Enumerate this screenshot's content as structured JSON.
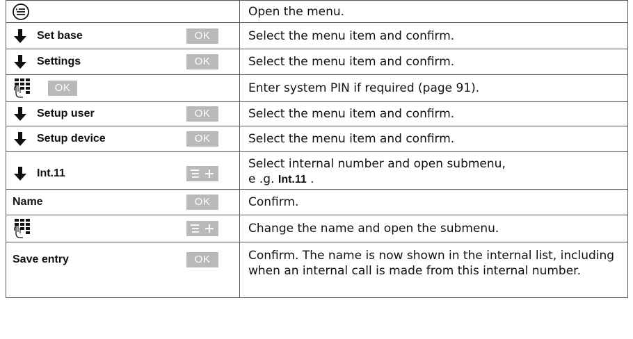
{
  "steps": [
    {
      "key": "menu-key-icon",
      "label": "",
      "button": "",
      "instruction": "Open the menu."
    },
    {
      "key": "arrow-down-icon",
      "label": "Set base",
      "button": "OK",
      "instruction": "Select the menu item and confirm."
    },
    {
      "key": "arrow-down-icon",
      "label": "Settings",
      "button": "OK",
      "instruction": "Select the menu item and confirm."
    },
    {
      "key": "keypad-icon",
      "label": "",
      "button": "OK",
      "instruction": "Enter system PIN if required (page 91)."
    },
    {
      "key": "arrow-down-icon",
      "label": "Setup user",
      "button": "OK",
      "instruction": "Select the menu item and confirm."
    },
    {
      "key": "arrow-down-icon",
      "label": "Setup device",
      "button": "OK",
      "instruction": "Select the menu item and confirm."
    },
    {
      "key": "arrow-down-icon",
      "label": "Int.11",
      "button": "submenu-key-icon",
      "instruction_line1": "Select internal number and open submenu,",
      "instruction_prefix": "e .g. ",
      "instruction_strong": "Int.11",
      "instruction_suffix": " ."
    },
    {
      "key": "",
      "label": "Name",
      "button": "OK",
      "instruction": "Confirm."
    },
    {
      "key": "keypad-icon",
      "label": "",
      "button": "submenu-key-icon",
      "instruction": "Change the name and open the submenu."
    },
    {
      "key": "",
      "label": "Save entry",
      "button": "OK",
      "instruction": "Confirm. The name is now shown in the internal list, including when an internal call is made from this internal number."
    }
  ],
  "colors": {
    "softkey_bg": "#b9b9b9",
    "softkey_text": "#ffffff",
    "border": "#555555"
  }
}
